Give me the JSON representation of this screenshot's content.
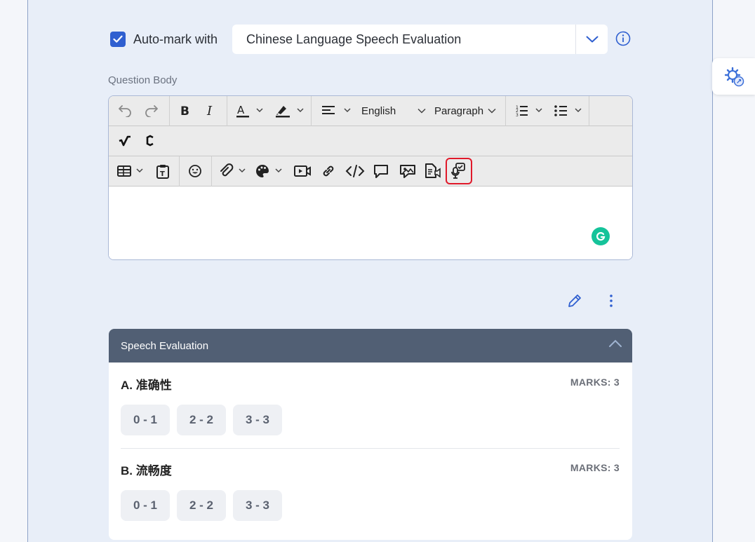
{
  "automark": {
    "label": "Auto-mark with",
    "checked": true,
    "selected_option": "Chinese Language Speech Evaluation"
  },
  "question_body": {
    "label": "Question Body",
    "language_select": "English",
    "block_format_select": "Paragraph"
  },
  "speech_evaluation": {
    "title": "Speech Evaluation",
    "criteria": [
      {
        "title": "A. 准确性",
        "marks": "MARKS: 3",
        "ranges": [
          "0 - 1",
          "2 - 2",
          "3 - 3"
        ]
      },
      {
        "title": "B. 流畅度",
        "marks": "MARKS: 3",
        "ranges": [
          "0 - 1",
          "2 - 2",
          "3 - 3"
        ]
      }
    ]
  },
  "colors": {
    "accent": "#2f5fd0",
    "panel_bg": "#e8eef8",
    "card_header": "#515f74",
    "highlight": "#e0192a",
    "grammarly": "#15c39a"
  },
  "icons": [
    "checkbox-check-icon",
    "chevron-down-icon",
    "info-icon",
    "undo-icon",
    "redo-icon",
    "bold-icon",
    "italic-icon",
    "font-color-icon",
    "highlight-color-icon",
    "align-icon",
    "numbered-list-icon",
    "bulleted-list-icon",
    "math-equation-icon",
    "chemistry-icon",
    "table-icon",
    "paste-text-icon",
    "emoji-icon",
    "attachment-icon",
    "palette-icon",
    "video-icon",
    "link-icon",
    "code-icon",
    "comment-icon",
    "image-speech-icon",
    "audio-file-icon",
    "speech-evaluation-icon",
    "grammarly-icon",
    "pencil-icon",
    "more-vertical-icon",
    "chevron-up-icon",
    "settings-sync-icon"
  ]
}
